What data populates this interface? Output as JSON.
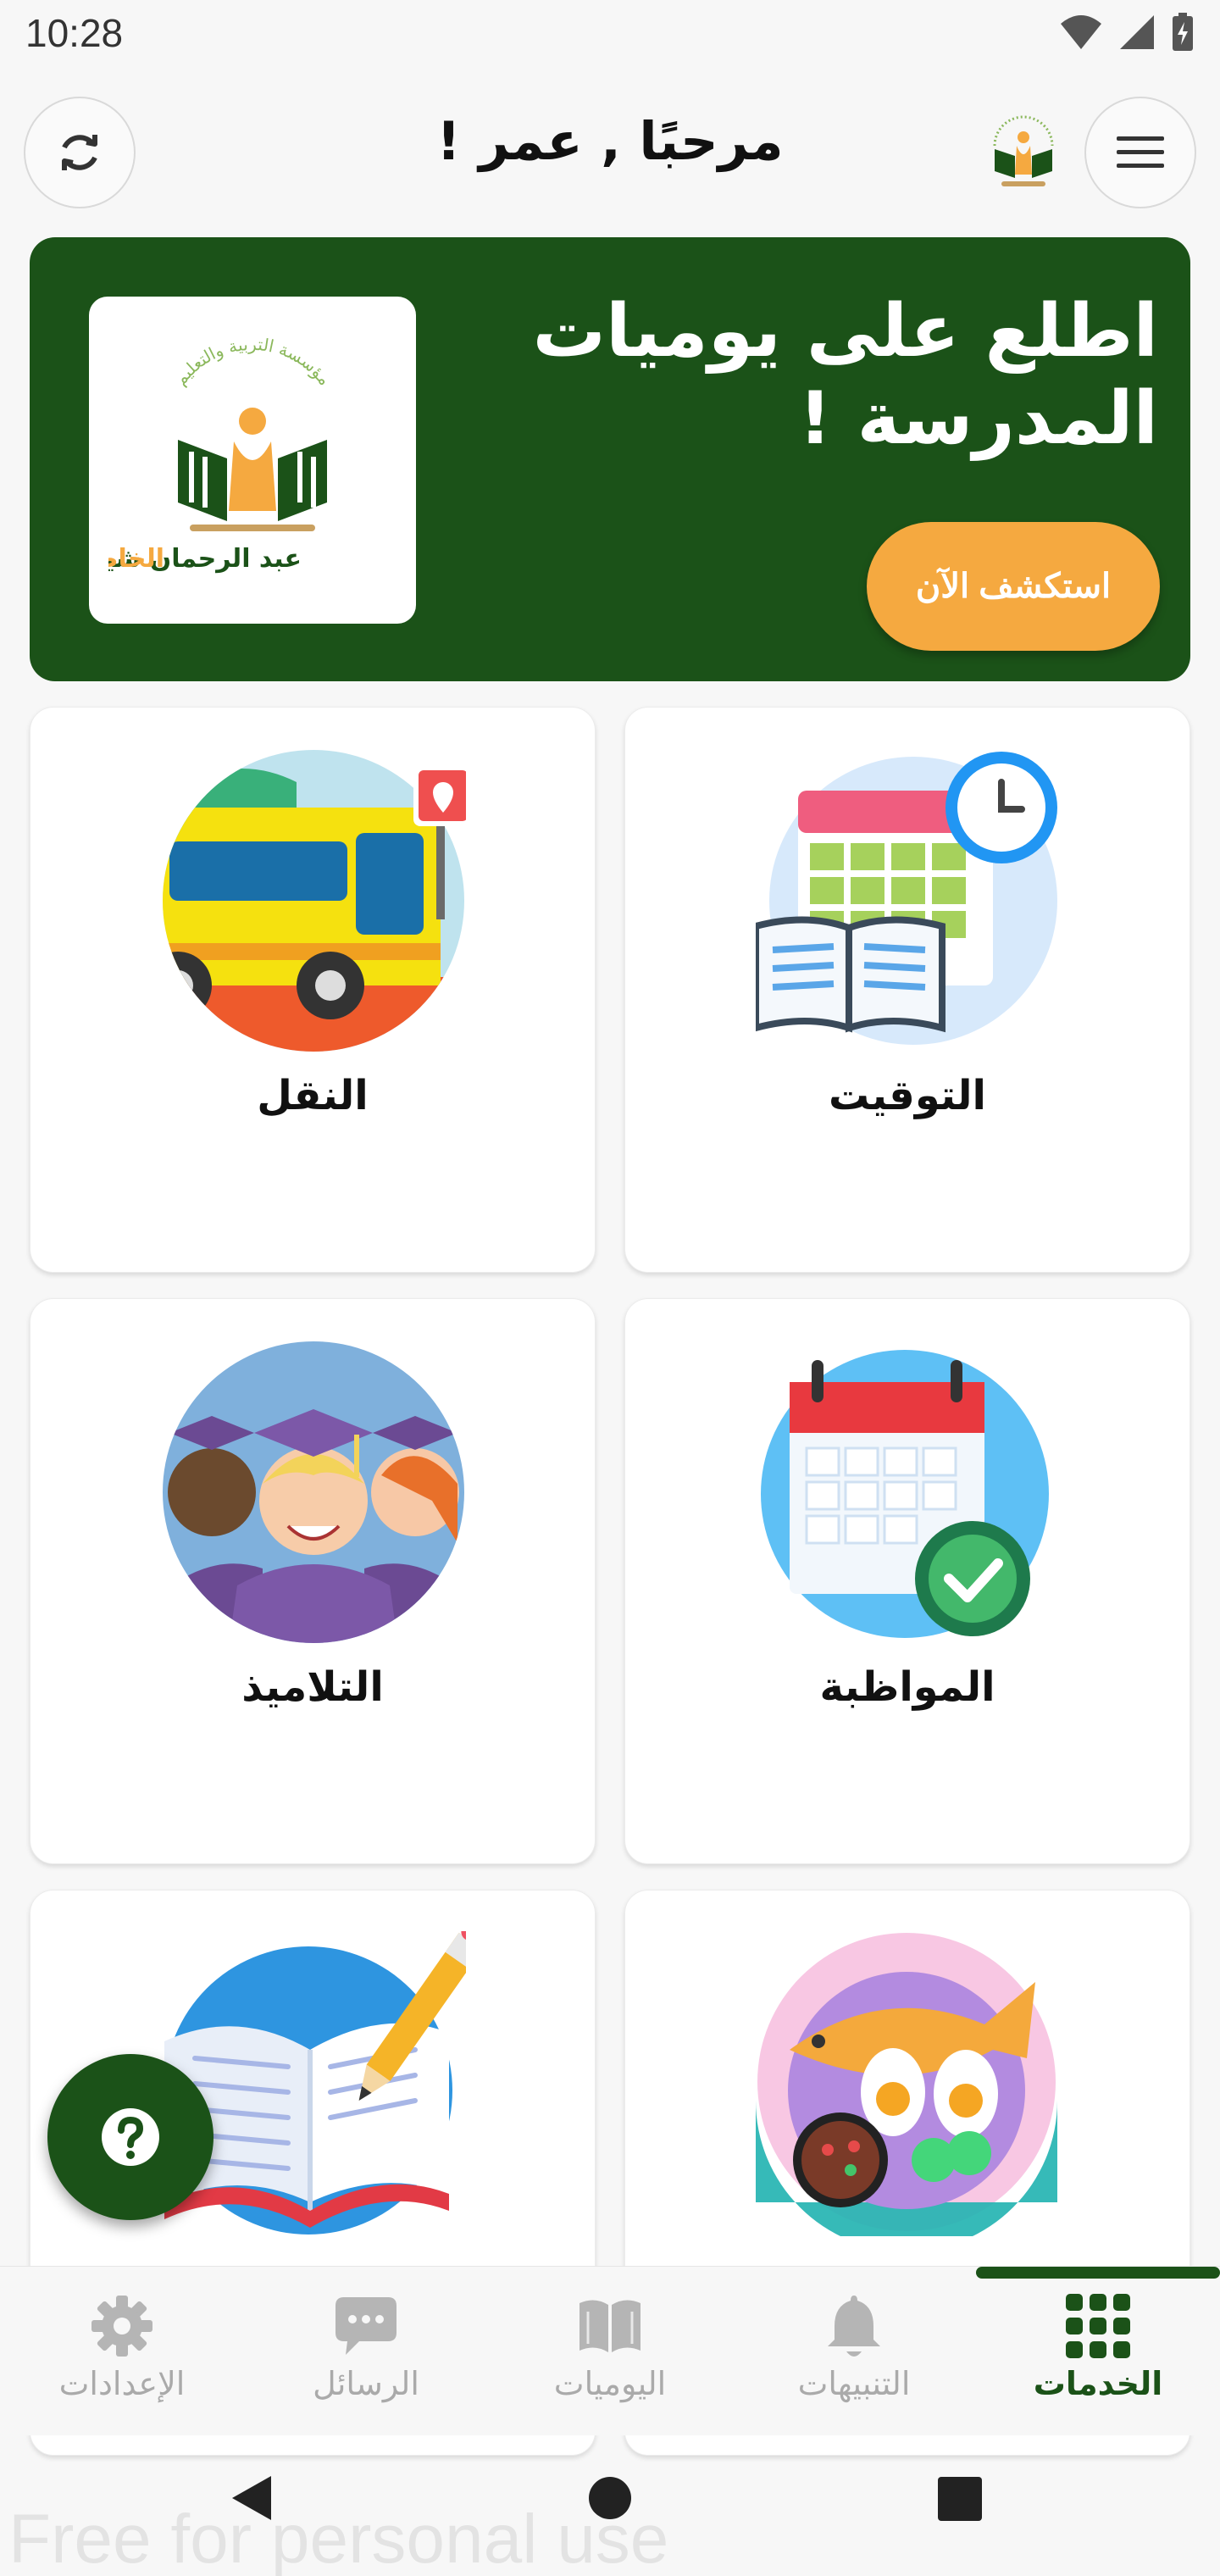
{
  "status_bar": {
    "time": "10:28"
  },
  "header": {
    "title": "مرحبًا , عمر !",
    "refresh_icon": "refresh-icon",
    "menu_icon": "hamburger-menu-icon"
  },
  "banner": {
    "title": "اطلع على يوميات المدرسة !",
    "button_label": "استكشف الآن",
    "logo": {
      "arc_text": "مؤسسة التربية والتعليم",
      "name_main": "عبد الرحمان شيبان",
      "name_accent": "الخاصة"
    },
    "colors": {
      "background": "#1b5218",
      "button": "#f5a940"
    }
  },
  "services": [
    {
      "id": "timetable",
      "label": "التوقيت",
      "icon": "timetable-calendar-icon"
    },
    {
      "id": "transport",
      "label": "النقل",
      "icon": "school-bus-icon"
    },
    {
      "id": "attendance",
      "label": "المواظبة",
      "icon": "attendance-calendar-icon"
    },
    {
      "id": "students",
      "label": "التلاميذ",
      "icon": "graduates-icon"
    },
    {
      "id": "canteen",
      "label": "",
      "icon": "meal-plate-icon"
    },
    {
      "id": "homework",
      "label": "",
      "icon": "notebook-pencil-icon"
    }
  ],
  "fab": {
    "icon": "help-question-icon"
  },
  "bottom_nav": {
    "items": [
      {
        "label": "الخدمات",
        "icon": "grid-icon",
        "active": true
      },
      {
        "label": "التنبيهات",
        "icon": "bell-icon",
        "active": false
      },
      {
        "label": "اليوميات",
        "icon": "book-icon",
        "active": false
      },
      {
        "label": "الرسائل",
        "icon": "chat-icon",
        "active": false
      },
      {
        "label": "الإعدادات",
        "icon": "gear-icon",
        "active": false
      }
    ],
    "active_color": "#1b5218",
    "inactive_color": "#aaaaaa"
  },
  "watermark": "Free for personal use"
}
